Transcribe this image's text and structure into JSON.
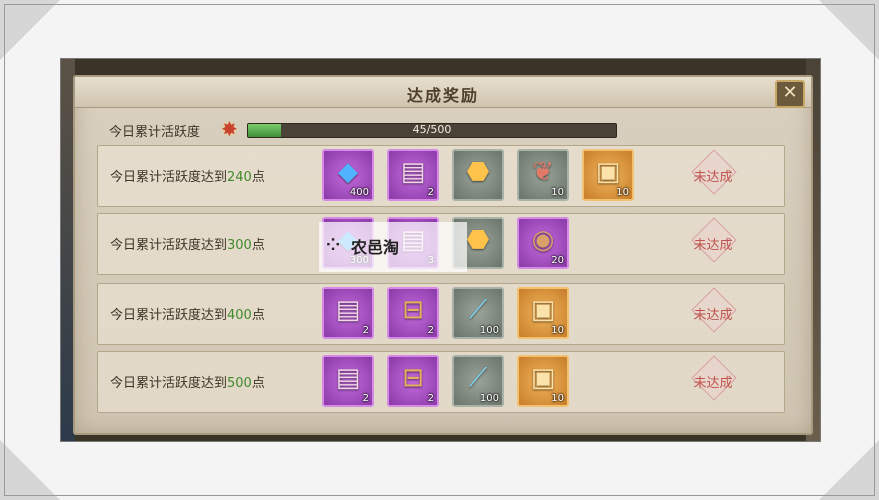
{
  "dialog": {
    "title": "达成奖励",
    "close_symbol": "✕"
  },
  "total": {
    "label": "今日累计活跃度",
    "progress_text": "45/500",
    "current": 45,
    "max": 500
  },
  "rows": [
    {
      "label_prefix": "今日累计活跃度达到",
      "points": "240",
      "suffix": "点",
      "status": "未达成",
      "items": [
        {
          "icon": "blue-gem-icon",
          "rarity": "purple",
          "count": "400"
        },
        {
          "icon": "card-icon",
          "rarity": "purple",
          "count": "2"
        },
        {
          "icon": "amber-crystal-icon",
          "rarity": "gray",
          "count": ""
        },
        {
          "icon": "meat-icon",
          "rarity": "gray",
          "count": "10"
        },
        {
          "icon": "scroll-card-icon",
          "rarity": "orange",
          "count": "10"
        }
      ]
    },
    {
      "label_prefix": "今日累计活跃度达到",
      "points": "300",
      "suffix": "点",
      "status": "未达成",
      "items": [
        {
          "icon": "blue-gem-icon",
          "rarity": "purple",
          "count": "300"
        },
        {
          "icon": "card-icon",
          "rarity": "purple",
          "count": "3"
        },
        {
          "icon": "amber-crystal-icon",
          "rarity": "gray",
          "count": ""
        },
        {
          "icon": "bronze-medal-icon",
          "rarity": "purple",
          "count": "20"
        }
      ]
    },
    {
      "label_prefix": "今日累计活跃度达到",
      "points": "400",
      "suffix": "点",
      "status": "未达成",
      "items": [
        {
          "icon": "card-icon",
          "rarity": "purple",
          "count": "2"
        },
        {
          "icon": "treasure-chest-icon",
          "rarity": "purple",
          "count": "2"
        },
        {
          "icon": "potion-syringe-icon",
          "rarity": "gray",
          "count": "100"
        },
        {
          "icon": "scroll-card-icon",
          "rarity": "orange",
          "count": "10"
        }
      ]
    },
    {
      "label_prefix": "今日累计活跃度达到",
      "points": "500",
      "suffix": "点",
      "status": "未达成",
      "items": [
        {
          "icon": "card-icon",
          "rarity": "purple",
          "count": "2"
        },
        {
          "icon": "treasure-chest-icon",
          "rarity": "purple",
          "count": "2"
        },
        {
          "icon": "potion-syringe-icon",
          "rarity": "gray",
          "count": "100"
        },
        {
          "icon": "scroll-card-icon",
          "rarity": "orange",
          "count": "10"
        }
      ]
    }
  ],
  "watermark": {
    "logo_glyph": "⁘",
    "text": "农邑淘"
  },
  "colors": {
    "accent_green": "#3f8a2b",
    "status_red": "#c0544f",
    "panel": "#d9d0bf"
  }
}
